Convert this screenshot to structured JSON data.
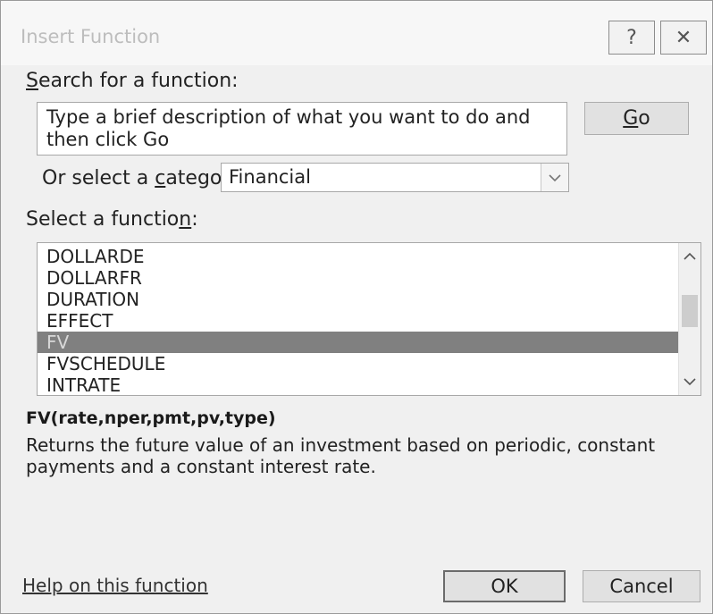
{
  "window": {
    "title": "Insert Function",
    "help_glyph": "?",
    "close_glyph": "✕"
  },
  "search": {
    "label_hotkey": "S",
    "label_rest": "earch for a function:",
    "value": "Type a brief description of what you want to do and then click Go",
    "go_hotkey": "G",
    "go_rest": "o"
  },
  "category": {
    "label_pre": "Or select a ",
    "label_hotkey": "c",
    "label_post": "ategory:",
    "selected": "Financial",
    "arrow_icon": "chevron-down-icon"
  },
  "function_list": {
    "label_pre": "Select a functio",
    "label_hotkey": "n",
    "label_post": ":",
    "items": [
      "DOLLARDE",
      "DOLLARFR",
      "DURATION",
      "EFFECT",
      "FV",
      "FVSCHEDULE",
      "INTRATE"
    ],
    "selected_index": 4
  },
  "details": {
    "signature": "FV(rate,nper,pmt,pv,type)",
    "description": "Returns the future value of an investment based on periodic, constant payments and a constant interest rate."
  },
  "footer": {
    "help_link": "Help on this function",
    "ok_label": "OK",
    "cancel_label": "Cancel"
  },
  "colors": {
    "selection_bg": "#808080",
    "dialog_bg": "#f0f0f0",
    "button_bg": "#e1e1e1"
  }
}
